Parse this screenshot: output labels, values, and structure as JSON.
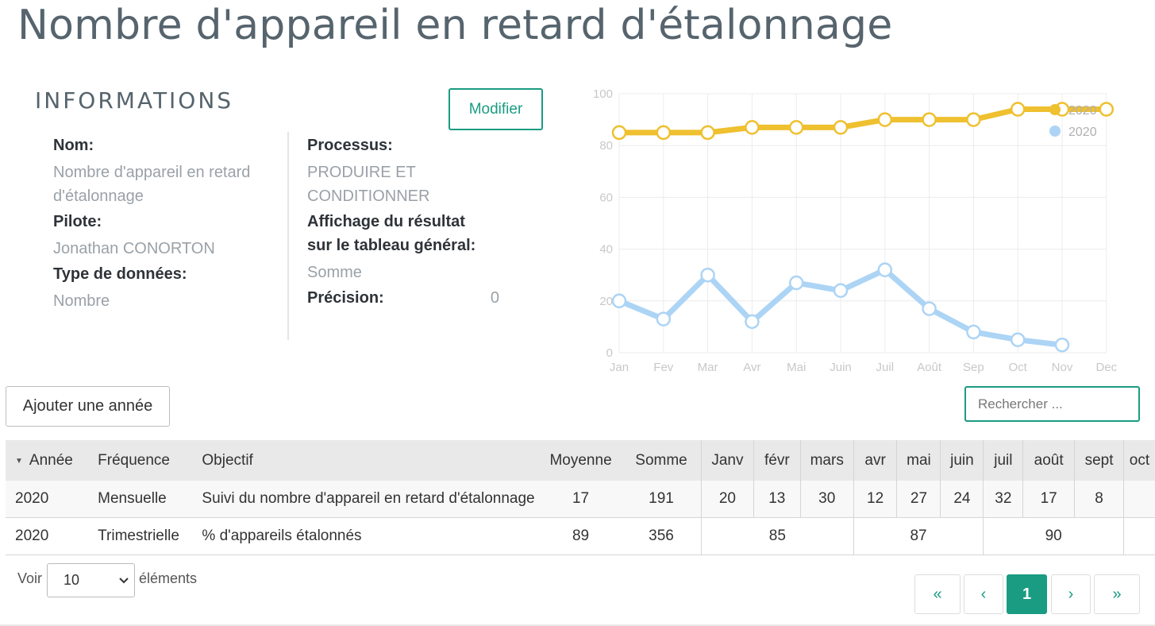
{
  "page": {
    "title": "Nombre d'appareil en retard d'étalonnage"
  },
  "info": {
    "section_title": "INFORMATIONS",
    "modify_label": "Modifier",
    "nom_label": "Nom:",
    "nom_value": "Nombre d'appareil en retard d'étalonnage",
    "pilote_label": "Pilote:",
    "pilote_value": "Jonathan CONORTON",
    "type_label": "Type de données:",
    "type_value": "Nombre",
    "processus_label": "Processus:",
    "processus_value": "PRODUIRE ET CONDITIONNER",
    "affichage_label": "Affichage du résultat sur le tableau général:",
    "affichage_value": "Somme",
    "precision_label": "Précision:",
    "precision_value": "0"
  },
  "chart_data": {
    "type": "line",
    "categories": [
      "Jan",
      "Fev",
      "Mar",
      "Avr",
      "Mai",
      "Juin",
      "Juil",
      "Août",
      "Sep",
      "Oct",
      "Nov",
      "Dec"
    ],
    "ylim": [
      0,
      100
    ],
    "yticks": [
      0,
      20,
      40,
      60,
      80,
      100
    ],
    "grid": true,
    "legend_position": "top-right",
    "series": [
      {
        "name": "2020",
        "color": "#efc02f",
        "values": [
          85,
          85,
          85,
          87,
          87,
          87,
          90,
          90,
          90,
          94,
          94,
          94
        ]
      },
      {
        "name": "2020",
        "color": "#acd4f5",
        "values": [
          20,
          13,
          30,
          12,
          27,
          24,
          32,
          17,
          8,
          5,
          3,
          null
        ]
      }
    ]
  },
  "toolbar": {
    "add_year_label": "Ajouter une année",
    "search_placeholder": "Rechercher ..."
  },
  "table": {
    "headers": {
      "annee": "Année",
      "frequence": "Fréquence",
      "objectif": "Objectif",
      "moyenne": "Moyenne",
      "somme": "Somme",
      "months": [
        "Janv",
        "févr",
        "mars",
        "avr",
        "mai",
        "juin",
        "juil",
        "août",
        "sept",
        "oct"
      ]
    },
    "monthly_row": {
      "annee": "2020",
      "frequence": "Mensuelle",
      "objectif": "Suivi du nombre d'appareil en retard d'étalonnage",
      "moyenne": "17",
      "somme": "191",
      "months": [
        "20",
        "13",
        "30",
        "12",
        "27",
        "24",
        "32",
        "17",
        "8",
        ""
      ]
    },
    "quarterly_row": {
      "annee": "2020",
      "frequence": "Trimestrielle",
      "objectif": "% d'appareils étalonnés",
      "moyenne": "89",
      "somme": "356",
      "quarters": [
        "85",
        "87",
        "90",
        ""
      ]
    }
  },
  "pagination": {
    "voir_label": "Voir",
    "page_size": "10",
    "elements_label": "éléments",
    "first": "«",
    "prev": "‹",
    "current": "1",
    "next": "›",
    "last": "»"
  }
}
